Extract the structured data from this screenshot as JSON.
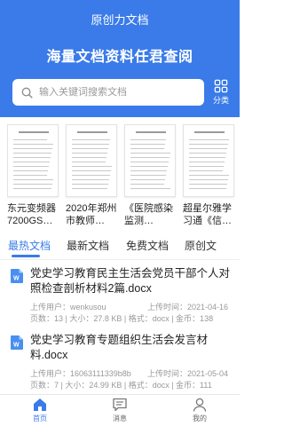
{
  "header": {
    "app_title": "原创力文档",
    "slogan": "海量文档资料任君查阅"
  },
  "search": {
    "placeholder": "输入关键词搜索文档"
  },
  "category_button": {
    "label": "分类"
  },
  "recommended": [
    {
      "caption": "东元变频器7200GS…"
    },
    {
      "caption": "2020年郑州市教师…"
    },
    {
      "caption": "《医院感染监测…"
    },
    {
      "caption": "超星尔雅学习通《信…"
    }
  ],
  "tabs": [
    {
      "label": "最热文档",
      "active": true
    },
    {
      "label": "最新文档",
      "active": false
    },
    {
      "label": "免费文档",
      "active": false
    },
    {
      "label": "原创文",
      "active": false
    }
  ],
  "documents": [
    {
      "title": "党史学习教育民主生活会党员干部个人对照检查剖析材料2篇.docx",
      "uploader_line": "上传用户：wenkusou",
      "upload_time_line": "上传时间：2021-04-16",
      "stats_line": "页数：13 | 大小：27.8 KB | 格式：docx | 金币：138"
    },
    {
      "title": "党史学习教育专题组织生活会发言材料.docx",
      "uploader_line": "上传用户：16063111339b8b",
      "upload_time_line": "上传时间：2021-05-04",
      "stats_line": "页数：7 | 大小：24.99 KB | 格式：docx | 金币：111"
    }
  ],
  "bottom_nav": [
    {
      "label": "首页",
      "icon": "home-icon",
      "active": true
    },
    {
      "label": "消息",
      "icon": "message-icon",
      "active": false
    },
    {
      "label": "我的",
      "icon": "user-icon",
      "active": false
    }
  ],
  "colors": {
    "primary": "#3a7be9",
    "doc_icon": "#4a8ff0",
    "meta_text": "#999999"
  }
}
